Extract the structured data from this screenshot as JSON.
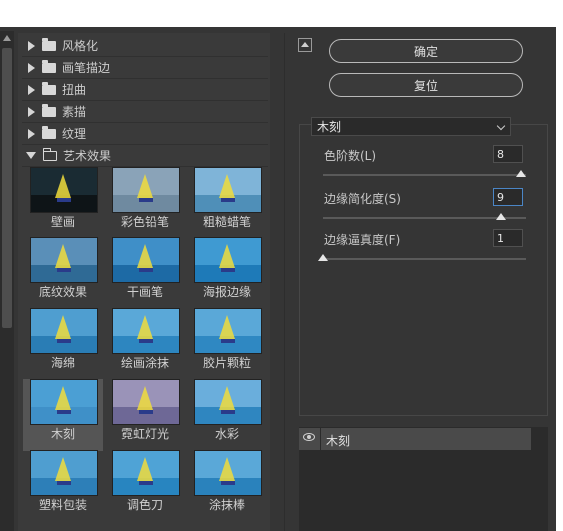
{
  "categories": [
    {
      "label": "风格化",
      "open": false
    },
    {
      "label": "画笔描边",
      "open": false
    },
    {
      "label": "扭曲",
      "open": false
    },
    {
      "label": "素描",
      "open": false
    },
    {
      "label": "纹理",
      "open": false
    },
    {
      "label": "艺术效果",
      "open": true
    }
  ],
  "filters": [
    {
      "label": "壁画",
      "icon": "mural-thumbnail",
      "sky": "#1a2b33",
      "sea": "#0e1417"
    },
    {
      "label": "彩色铅笔",
      "icon": "colored-pencil-thumbnail",
      "sky": "#8aa3b8",
      "sea": "#6f8aa0"
    },
    {
      "label": "粗糙蜡笔",
      "icon": "rough-pastels-thumbnail",
      "sky": "#7fb4d8",
      "sea": "#4f8fb8"
    },
    {
      "label": "底纹效果",
      "icon": "underpainting-thumbnail",
      "sky": "#5a8fb8",
      "sea": "#2f6a95"
    },
    {
      "label": "干画笔",
      "icon": "dry-brush-thumbnail",
      "sky": "#3f8fc8",
      "sea": "#1d6aa5"
    },
    {
      "label": "海报边缘",
      "icon": "poster-edges-thumbnail",
      "sky": "#3f9ad2",
      "sea": "#1e7ab8"
    },
    {
      "label": "海绵",
      "icon": "sponge-thumbnail",
      "sky": "#4f9ed0",
      "sea": "#2a7db5"
    },
    {
      "label": "绘画涂抹",
      "icon": "paint-daubs-thumbnail",
      "sky": "#5aa8d8",
      "sea": "#2d86c0"
    },
    {
      "label": "胶片颗粒",
      "icon": "film-grain-thumbnail",
      "sky": "#5aa8d8",
      "sea": "#2f88c2"
    },
    {
      "label": "木刻",
      "icon": "cutout-thumbnail",
      "sky": "#4b9fd4",
      "sea": "#3f90c8"
    },
    {
      "label": "霓虹灯光",
      "icon": "neon-glow-thumbnail",
      "sky": "#9a93b8",
      "sea": "#6e6896"
    },
    {
      "label": "水彩",
      "icon": "watercolor-thumbnail",
      "sky": "#6aaedc",
      "sea": "#2f86c0"
    },
    {
      "label": "塑料包装",
      "icon": "plastic-wrap-thumbnail",
      "sky": "#4f9ed0",
      "sea": "#2d7fb8"
    },
    {
      "label": "调色刀",
      "icon": "palette-knife-thumbnail",
      "sky": "#4fa3d6",
      "sea": "#2885c0"
    },
    {
      "label": "涂抹棒",
      "icon": "smudge-stick-thumbnail",
      "sky": "#5aa8d8",
      "sea": "#2a82bc"
    }
  ],
  "selected_filter_index": 9,
  "buttons": {
    "ok": "确定",
    "reset": "复位"
  },
  "filter_dropdown": {
    "value": "木刻"
  },
  "params": [
    {
      "label": "色阶数(L)",
      "value": "8",
      "slider": 1.0
    },
    {
      "label": "边缘简化度(S)",
      "value": "9",
      "slider": 0.9
    },
    {
      "label": "边缘逼真度(F)",
      "value": "1",
      "slider": 0.0
    }
  ],
  "layers": [
    {
      "name": "木刻",
      "visible": true
    }
  ],
  "icons": {
    "collapse": "collapse-up-icon",
    "eye": "eye-icon",
    "folder": "folder-icon",
    "disclosure": "disclosure-triangle-icon"
  }
}
